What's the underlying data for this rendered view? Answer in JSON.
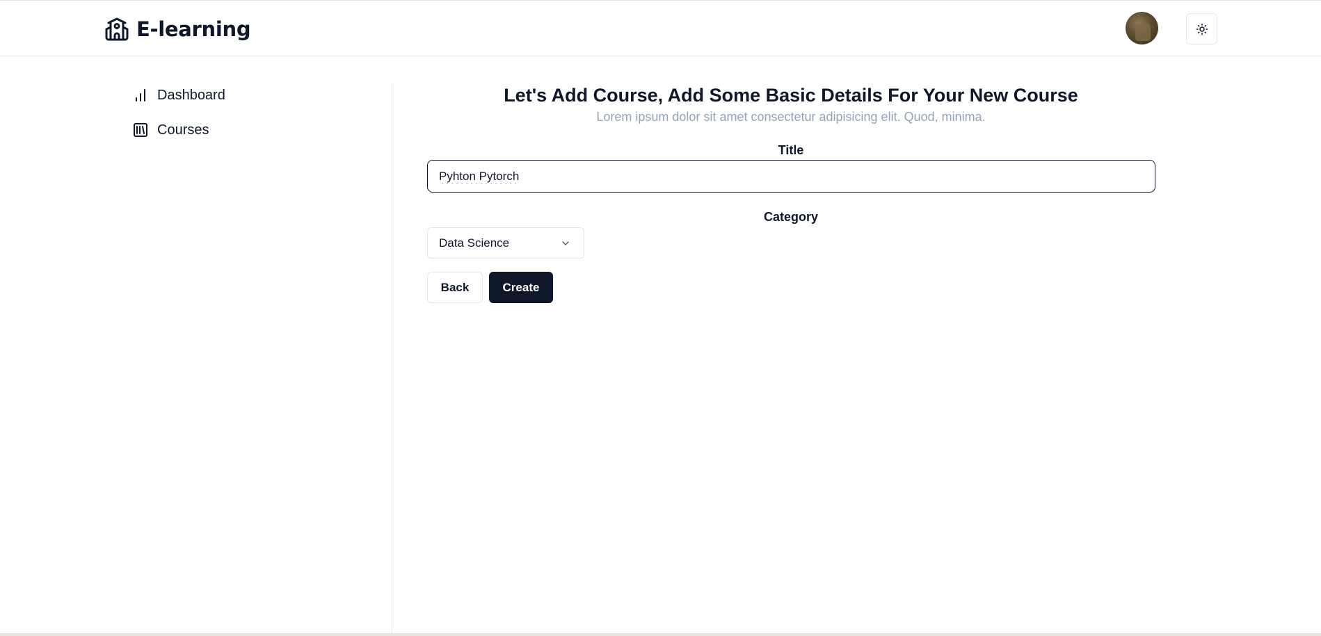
{
  "header": {
    "brand_name": "E-learning",
    "brand_icon": "school-icon",
    "avatar_icon": "user-avatar",
    "theme_toggle_icon": "sun-icon"
  },
  "sidebar": {
    "items": [
      {
        "label": "Dashboard",
        "icon": "bar-chart-icon"
      },
      {
        "label": "Courses",
        "icon": "library-icon"
      }
    ]
  },
  "form": {
    "heading": "Let's Add Course, Add Some Basic Details For Your New Course",
    "subheading": "Lorem ipsum dolor sit amet consectetur adipisicing elit. Quod, minima.",
    "title_label": "Title",
    "title_value": "Pyhton Pytorch",
    "category_label": "Category",
    "category_value": "Data Science",
    "back_label": "Back",
    "create_label": "Create"
  },
  "colors": {
    "primary": "#0f172a",
    "muted_text": "#94a3b8",
    "border": "#e5e7eb"
  }
}
